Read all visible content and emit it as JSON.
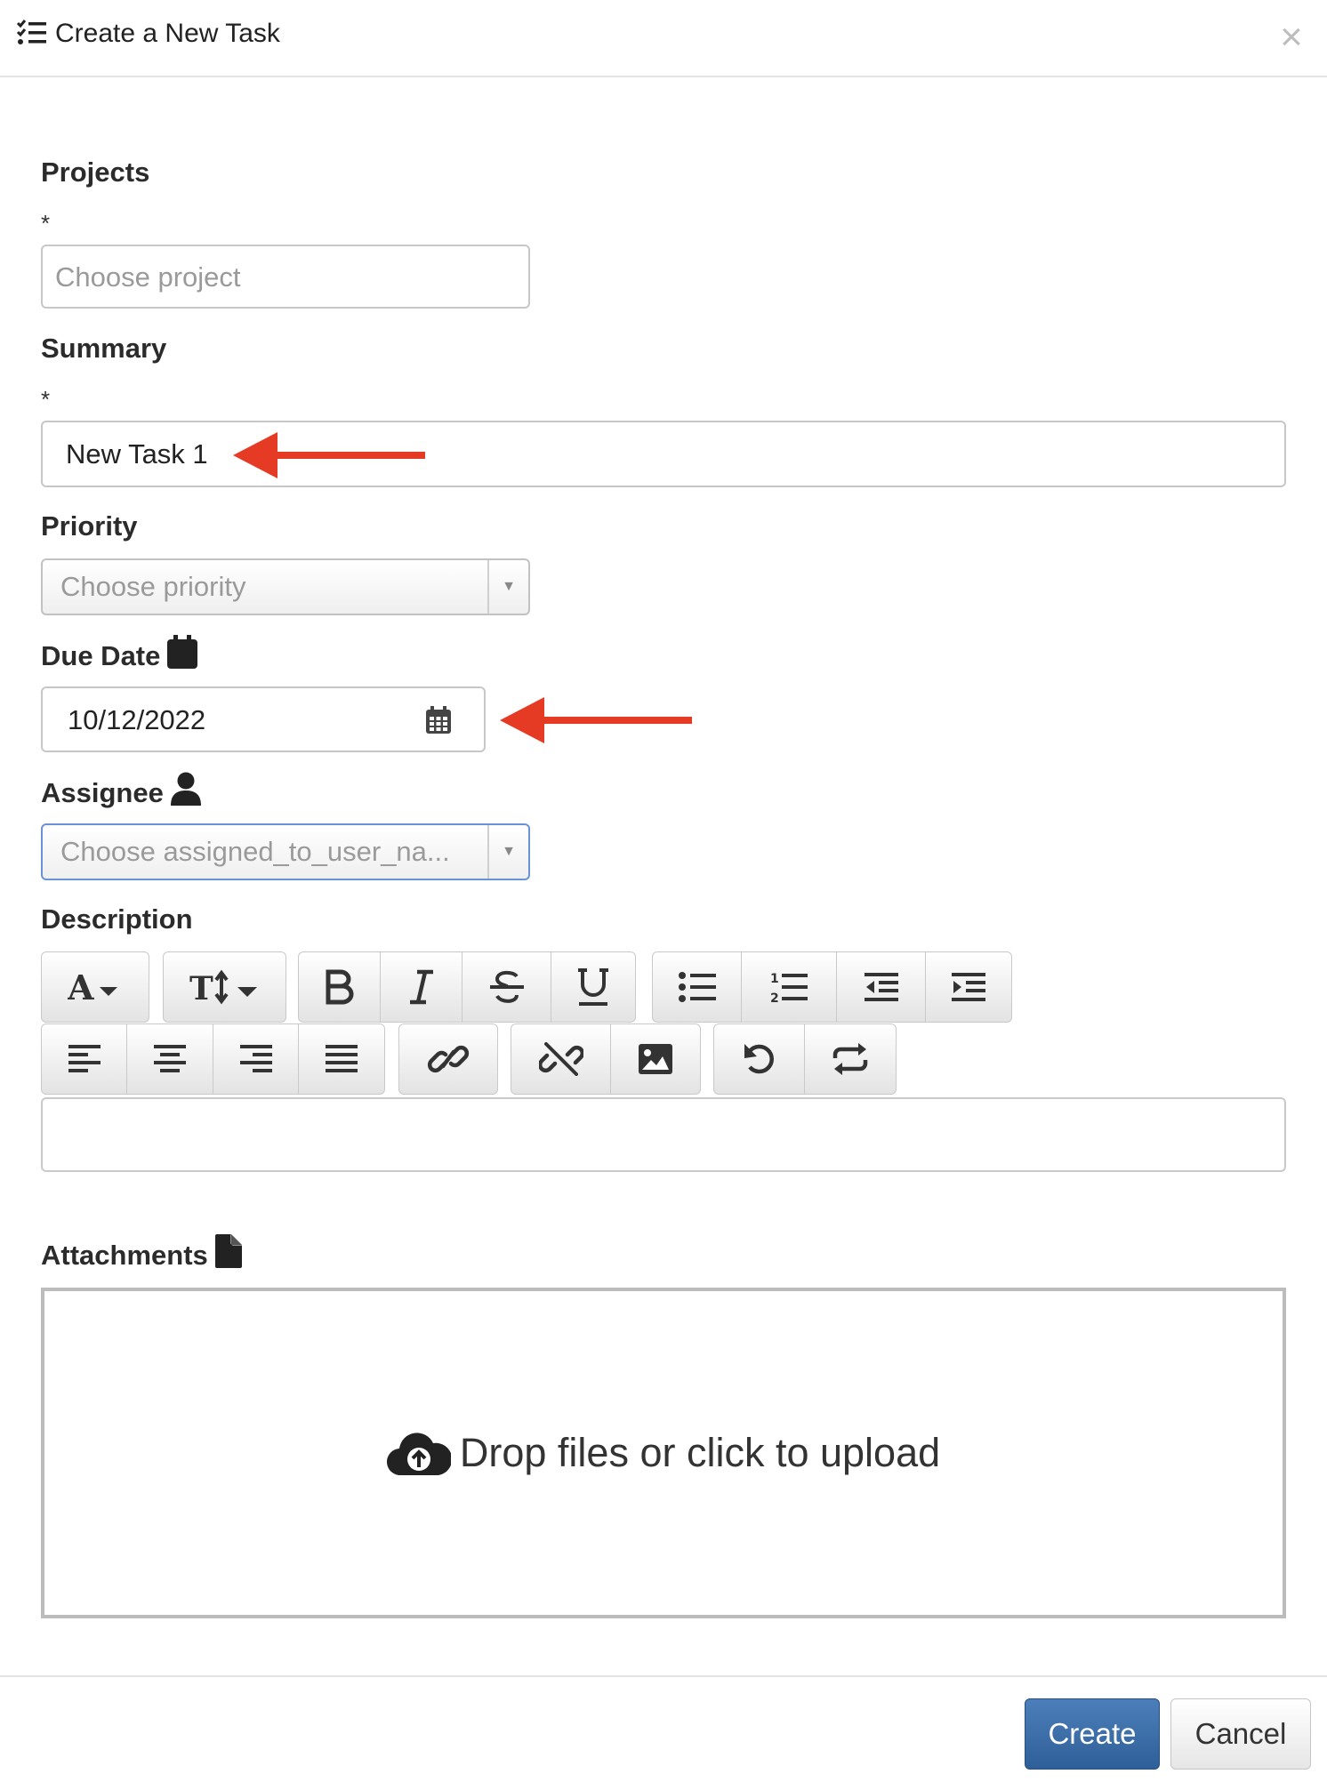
{
  "dialog": {
    "title": "Create a New Task",
    "title_icon": "task-list-icon",
    "close_icon": "close-icon",
    "close_glyph": "×"
  },
  "fields": {
    "projects": {
      "label": "Projects",
      "required_mark": "*",
      "placeholder": "Choose project",
      "value": ""
    },
    "summary": {
      "label": "Summary",
      "required_mark": "*",
      "value": "New Task 1"
    },
    "priority": {
      "label": "Priority",
      "placeholder": "Choose priority"
    },
    "due_date": {
      "label": "Due Date",
      "label_icon": "calendar-icon",
      "value": "10/12/2022",
      "input_icon": "calendar-grid-icon"
    },
    "assignee": {
      "label": "Assignee",
      "label_icon": "user-icon",
      "placeholder": "Choose assigned_to_user_na..."
    },
    "description": {
      "label": "Description",
      "toolbar_row1": [
        [
          "font-style-icon"
        ],
        [
          "font-size-icon"
        ],
        [
          "bold-icon",
          "italic-icon",
          "strikethrough-icon",
          "underline-icon"
        ],
        [
          "bullet-list-icon",
          "numbered-list-icon",
          "outdent-icon",
          "indent-icon"
        ]
      ],
      "toolbar_row2": [
        [
          "align-left-icon",
          "align-center-icon",
          "align-right-icon",
          "align-justify-icon"
        ],
        [
          "link-icon"
        ],
        [
          "unlink-icon",
          "image-icon"
        ],
        [
          "undo-icon",
          "redo-icon"
        ]
      ],
      "value": ""
    },
    "attachments": {
      "label": "Attachments",
      "label_icon": "file-icon",
      "dropzone_icon": "cloud-upload-icon",
      "dropzone_text": "Drop files or click to upload"
    }
  },
  "footer": {
    "create_label": "Create",
    "cancel_label": "Cancel"
  },
  "colors": {
    "annotation_arrow": "#e53a24",
    "primary_button": "#3467a6",
    "focus_border": "#6a92d8"
  }
}
